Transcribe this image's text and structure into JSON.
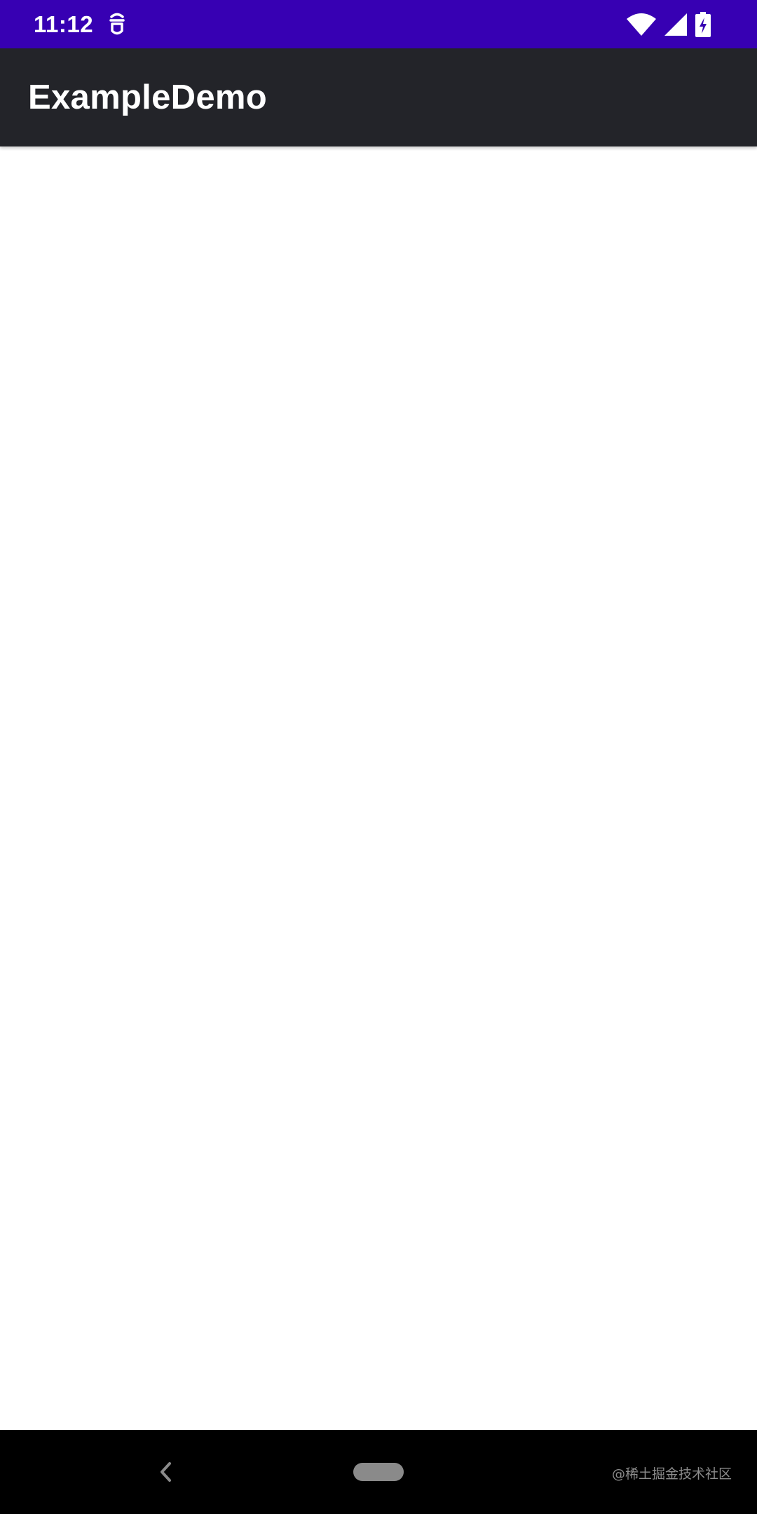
{
  "colors": {
    "status_bar": "#3700B3",
    "app_bar": "#232429",
    "content_bg": "#FFFFFF",
    "nav_bar": "#000000",
    "nav_home_pill": "#8A8A8A"
  },
  "status_bar": {
    "time": "11:12",
    "notification_icon": "sync-dev-icon",
    "wifi_icon": "wifi-icon",
    "signal_icon": "cell-signal-icon",
    "battery_icon": "battery-charging-icon"
  },
  "app_bar": {
    "title": "ExampleDemo"
  },
  "nav_bar": {
    "back_icon": "back-chevron-icon",
    "home_icon": "home-pill-icon",
    "watermark": "@稀土掘金技术社区"
  }
}
